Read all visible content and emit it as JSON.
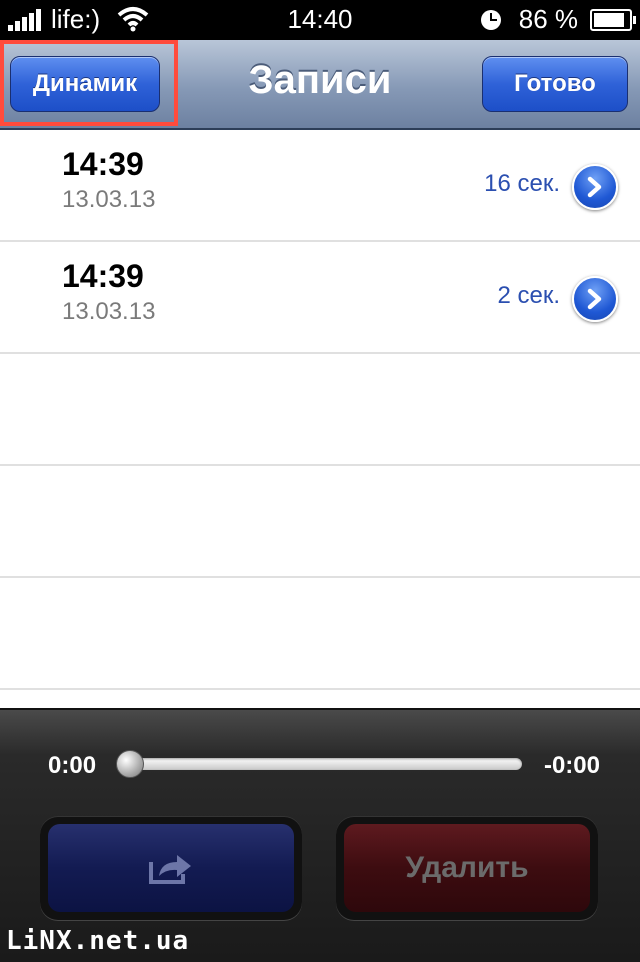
{
  "status_bar": {
    "carrier": "life:)",
    "time": "14:40",
    "battery": "86 %"
  },
  "nav": {
    "title": "Записи",
    "left_button": "Динамик",
    "right_button": "Готово"
  },
  "recordings": [
    {
      "time": "14:39",
      "date": "13.03.13",
      "duration": "16 сек."
    },
    {
      "time": "14:39",
      "date": "13.03.13",
      "duration": "2 сек."
    }
  ],
  "player": {
    "elapsed": "0:00",
    "remaining": "-0:00",
    "delete_label": "Удалить"
  },
  "watermark": "LiNX.net.ua",
  "colors": {
    "accent": "#2b4fb0",
    "highlight": "#ff4b3c"
  }
}
